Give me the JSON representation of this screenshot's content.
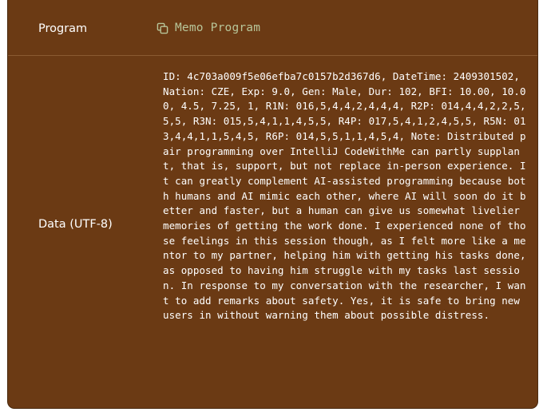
{
  "program": {
    "label": "Program",
    "value": "Memo Program",
    "icon": "copy-icon"
  },
  "data_row": {
    "label": "Data (UTF-8)",
    "value": "ID: 4c703a009f5e06efba7c0157b2d367d6, DateTime: 2409301502, Nation: CZE, Exp: 9.0, Gen: Male, Dur: 102, BFI: 10.00, 10.00, 4.5, 7.25, 1, R1N: 016,5,4,4,2,4,4,4, R2P: 014,4,4,2,2,5,5,5, R3N: 015,5,4,1,1,4,5,5, R4P: 017,5,4,1,2,4,5,5, R5N: 013,4,4,1,1,5,4,5, R6P: 014,5,5,1,1,4,5,4, Note: Distributed pair programming over IntelliJ CodeWithMe can partly supplant, that is, support, but not replace in-person experience. It can greatly complement AI-assisted programming because both humans and AI mimic each other, where AI will soon do it better and faster, but a human can give us somewhat livelier memories of getting the work done. I experienced none of those feelings in this session though, as I felt more like a mentor to my partner, helping him with getting his tasks done, as opposed to having him struggle with my tasks last session. In response to my conversation with the researcher, I want to add remarks about safety. Yes, it is safe to bring new users in without warning them about possible distress."
  },
  "colors": {
    "panel_bg": "#6b3a14",
    "divider": "#8a5a32",
    "program_link": "#b8c69a",
    "text": "#ffffff"
  }
}
